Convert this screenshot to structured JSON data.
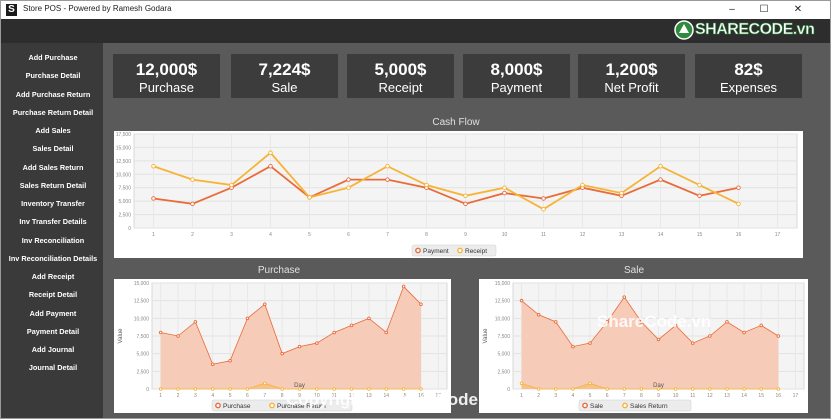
{
  "window": {
    "title": "Store POS - Powered by Ramesh Godara",
    "icon_letter": "S",
    "controls": {
      "minimize": "–",
      "maximize": "☐",
      "close": "✕"
    }
  },
  "sidebar": {
    "items": [
      {
        "label": "Add Purchase"
      },
      {
        "label": "Purchase Detail"
      },
      {
        "label": "Add Purchase Return"
      },
      {
        "label": "Purchase Return Detail"
      },
      {
        "label": "Add Sales"
      },
      {
        "label": "Sales Detail"
      },
      {
        "label": "Add Sales Return"
      },
      {
        "label": "Sales Return Detail"
      },
      {
        "label": "Inventory Transfer"
      },
      {
        "label": "Inv Transfer Details"
      },
      {
        "label": "Inv Reconciliation"
      },
      {
        "label": "Inv Reconciliation Details"
      },
      {
        "label": "Add Receipt"
      },
      {
        "label": "Receipt Detail"
      },
      {
        "label": "Add Payment"
      },
      {
        "label": "Payment Detail"
      },
      {
        "label": "Add Journal"
      },
      {
        "label": "Journal Detail"
      }
    ]
  },
  "cards": [
    {
      "value": "12,000$",
      "label": "Purchase"
    },
    {
      "value": "7,224$",
      "label": "Sale"
    },
    {
      "value": "5,000$",
      "label": "Receipt"
    },
    {
      "value": "8,000$",
      "label": "Payment"
    },
    {
      "value": "1,200$",
      "label": "Net Profit"
    },
    {
      "value": "82$",
      "label": "Expenses"
    }
  ],
  "colors": {
    "series_orange": "#e86c3a",
    "series_yellow": "#f6b335",
    "area_fill": "#f6cbb8",
    "card_bg": "#3c3c3c",
    "sidebar_bg": "#3a3a3a"
  },
  "watermarks": {
    "logo": "SHARECODE.vn",
    "center": "ShareCode.vn",
    "footer": "Copyright © ShareCode.vn"
  },
  "chart_data": [
    {
      "type": "line",
      "title": "Cash Flow",
      "x": [
        1,
        2,
        3,
        4,
        5,
        6,
        7,
        8,
        9,
        10,
        11,
        12,
        13,
        14,
        15,
        16,
        17
      ],
      "ylim": [
        0,
        17500
      ],
      "yticks": [
        "17,500",
        "15,000",
        "12,500",
        "10,000",
        "7,500",
        "5,000",
        "2,500",
        "0"
      ],
      "grid": true,
      "legend": "bottom",
      "series": [
        {
          "name": "Payment",
          "color": "#e86c3a",
          "values": [
            5500,
            4500,
            7500,
            11500,
            5700,
            9000,
            9000,
            7500,
            4500,
            6500,
            5500,
            7500,
            6000,
            9000,
            6000,
            7500,
            null
          ]
        },
        {
          "name": "Receipt",
          "color": "#f6b335",
          "values": [
            11500,
            9000,
            8000,
            14000,
            5700,
            7500,
            11500,
            8000,
            6000,
            7500,
            3500,
            8000,
            6500,
            11500,
            8000,
            4500,
            null
          ]
        }
      ]
    },
    {
      "type": "area",
      "title": "Purchase",
      "xlabel": "Day",
      "ylabel": "Value",
      "x": [
        1,
        2,
        3,
        4,
        5,
        6,
        7,
        8,
        9,
        10,
        11,
        12,
        13,
        14,
        15,
        16,
        17
      ],
      "ylim": [
        0,
        15000
      ],
      "yticks": [
        "15,000",
        "12,500",
        "10,000",
        "7,500",
        "5,000",
        "2,500",
        "0"
      ],
      "grid": true,
      "legend": "bottom",
      "series": [
        {
          "name": "Purchase",
          "color": "#e86c3a",
          "values": [
            8000,
            7500,
            9500,
            3500,
            4000,
            10000,
            12000,
            5000,
            6000,
            6500,
            8000,
            9000,
            10000,
            8000,
            14500,
            12000,
            null
          ]
        },
        {
          "name": "Purchase Return",
          "color": "#f6b335",
          "values": [
            0,
            0,
            0,
            0,
            0,
            0,
            800,
            0,
            0,
            0,
            0,
            0,
            0,
            0,
            0,
            0,
            null
          ]
        }
      ]
    },
    {
      "type": "area",
      "title": "Sale",
      "xlabel": "Day",
      "ylabel": "Value",
      "x": [
        1,
        2,
        3,
        4,
        5,
        6,
        7,
        8,
        9,
        10,
        11,
        12,
        13,
        14,
        15,
        16,
        17
      ],
      "ylim": [
        0,
        15000
      ],
      "yticks": [
        "15,000",
        "12,500",
        "10,000",
        "7,500",
        "5,000",
        "2,500",
        "0"
      ],
      "grid": true,
      "legend": "bottom",
      "series": [
        {
          "name": "Sale",
          "color": "#e86c3a",
          "values": [
            12500,
            10500,
            9500,
            6000,
            6500,
            9500,
            13000,
            9500,
            7000,
            9000,
            6500,
            7500,
            9500,
            8000,
            9000,
            7500,
            null
          ]
        },
        {
          "name": "Sales Return",
          "color": "#f6b335",
          "values": [
            800,
            0,
            0,
            0,
            800,
            0,
            0,
            0,
            0,
            0,
            0,
            0,
            0,
            0,
            0,
            0,
            null
          ]
        }
      ]
    }
  ]
}
